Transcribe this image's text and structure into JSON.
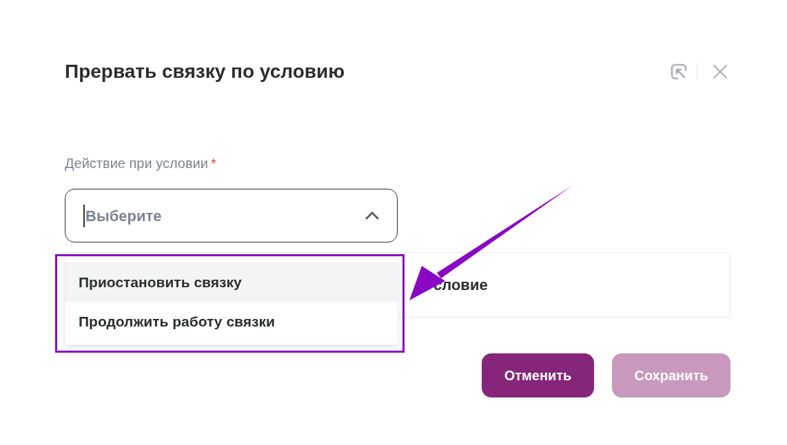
{
  "dialog": {
    "title": "Прервать связку по условию"
  },
  "field": {
    "label": "Действие при условии",
    "required_mark": "*",
    "placeholder": "Выберите",
    "expanded": true
  },
  "dropdown": {
    "options": [
      {
        "label": "Приостановить связку",
        "selected": true
      },
      {
        "label": "Продолжить работу связки",
        "selected": false
      }
    ]
  },
  "behind_button": {
    "label": "словие"
  },
  "buttons": [
    {
      "label": "Отменить",
      "disabled": false
    },
    {
      "label": "Сохранить",
      "disabled": true
    }
  ]
}
